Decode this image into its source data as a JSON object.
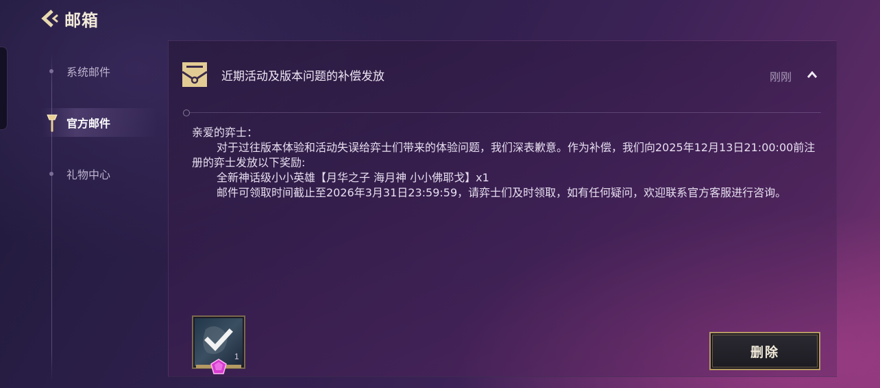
{
  "header": {
    "title": "邮箱",
    "back_icon": "chevron-left-icon"
  },
  "nav": {
    "items": [
      {
        "label": "系统邮件",
        "active": false
      },
      {
        "label": "官方邮件",
        "active": true,
        "icon": "torch-icon"
      },
      {
        "label": "礼物中心",
        "active": false
      }
    ]
  },
  "mail": {
    "icon": "mail-envelope-icon",
    "title": "近期活动及版本问题的补偿发放",
    "time": "刚刚",
    "collapse_icon": "chevron-up-icon",
    "greeting": "亲爱的弈士：",
    "paragraph1": "对于过往版本体验和活动失误给弈士们带来的体验问题，我们深表歉意。作为补偿，我们向2025年12月13日21:00:00前注册的弈士发放以下奖励:",
    "paragraph2": "全新神话级小小英雄【月华之子  海月神  小小佛耶戈】x1",
    "paragraph3": "邮件可领取时间截止至2026年3月31日23:59:59，请弈士们及时领取，如有任何疑问，欢迎联系官方客服进行咨询。",
    "attachment": {
      "count": "1",
      "claimed": true,
      "rarity_icon": "pink-gem-icon",
      "check_icon": "checkmark-icon"
    },
    "delete_label": "删除"
  },
  "colors": {
    "accent_gold": "#b59a63",
    "gem_pink": "#d63ccf"
  }
}
